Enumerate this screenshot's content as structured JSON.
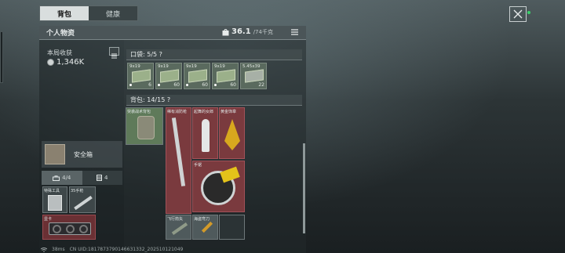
{
  "tabs": [
    {
      "label": "背包"
    },
    {
      "label": "健康"
    }
  ],
  "header": {
    "title": "个人物资",
    "weight_value": "36.1",
    "weight_max": "/74千克"
  },
  "left": {
    "earnings_label": "本局收获",
    "earnings_value": "1,346K",
    "safe_label": "安全箱",
    "subtabs": [
      {
        "label": "4/4",
        "icon": "toolbox-icon"
      },
      {
        "label": "4",
        "icon": "cabinet-icon"
      }
    ],
    "storage_items": [
      {
        "label": "特殊工具"
      },
      {
        "label": "35手枪"
      },
      {
        "label": "显卡"
      }
    ]
  },
  "pockets": {
    "label": "口袋: 5/5 ?",
    "ammo": [
      {
        "caliber": "9x19",
        "count": "6"
      },
      {
        "caliber": "9x19",
        "count": "60"
      },
      {
        "caliber": "9x19",
        "count": "60"
      },
      {
        "caliber": "9x19",
        "count": "60"
      },
      {
        "caliber": "5.45x39",
        "count": "22"
      }
    ]
  },
  "backpack": {
    "label": "背包: 14/15 ?",
    "items": [
      {
        "label": "突袭战术背包"
      },
      {
        "label": "稀有消防枪"
      },
      {
        "label": "起舞的女郎"
      },
      {
        "label": "黄金饰章"
      },
      {
        "label": "手锯"
      },
      {
        "label": "飞行箭矢"
      },
      {
        "label": "海盗弯刀"
      }
    ]
  },
  "status": {
    "ping": "38ms",
    "uid": "CN UID:1817873790146631332_202510121049"
  },
  "colors": {
    "accent_green": "#39d36a",
    "rare_red": "#7a3a3e",
    "gear_green": "#5f7a5a"
  }
}
